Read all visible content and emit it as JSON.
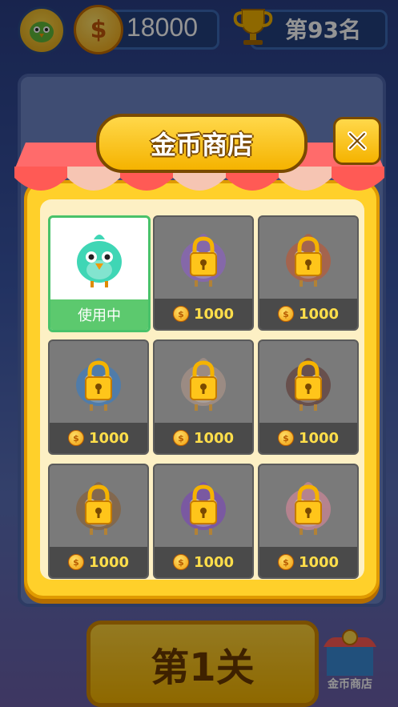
{
  "header": {
    "coins": "18000",
    "rank": "第93名",
    "coin_symbol": "$"
  },
  "modal": {
    "title": "金币商店",
    "close_label": "✕"
  },
  "birds": [
    {
      "name": "teal-bird",
      "color": "#3fd6b5",
      "status": "使用中",
      "locked": false
    },
    {
      "name": "purple-bird",
      "color": "#8f5bd1",
      "price": "1000",
      "locked": true
    },
    {
      "name": "red-bird",
      "color": "#c8532b",
      "price": "1000",
      "locked": true
    },
    {
      "name": "blue-bird",
      "color": "#2f7fd0",
      "price": "1000",
      "locked": true
    },
    {
      "name": "sparrow-bird",
      "color": "#b79a8a",
      "price": "1000",
      "locked": true
    },
    {
      "name": "dark-bird",
      "color": "#5a2f28",
      "price": "1000",
      "locked": true
    },
    {
      "name": "brown-bird",
      "color": "#8a5a2a",
      "price": "1000",
      "locked": true
    },
    {
      "name": "violet-bird",
      "color": "#7a3fc2",
      "price": "1000",
      "locked": true
    },
    {
      "name": "pink-bird",
      "color": "#e58aa0",
      "price": "1000",
      "locked": true
    }
  ],
  "footer": {
    "level_label": "第1关",
    "shop_label": "金币商店"
  }
}
